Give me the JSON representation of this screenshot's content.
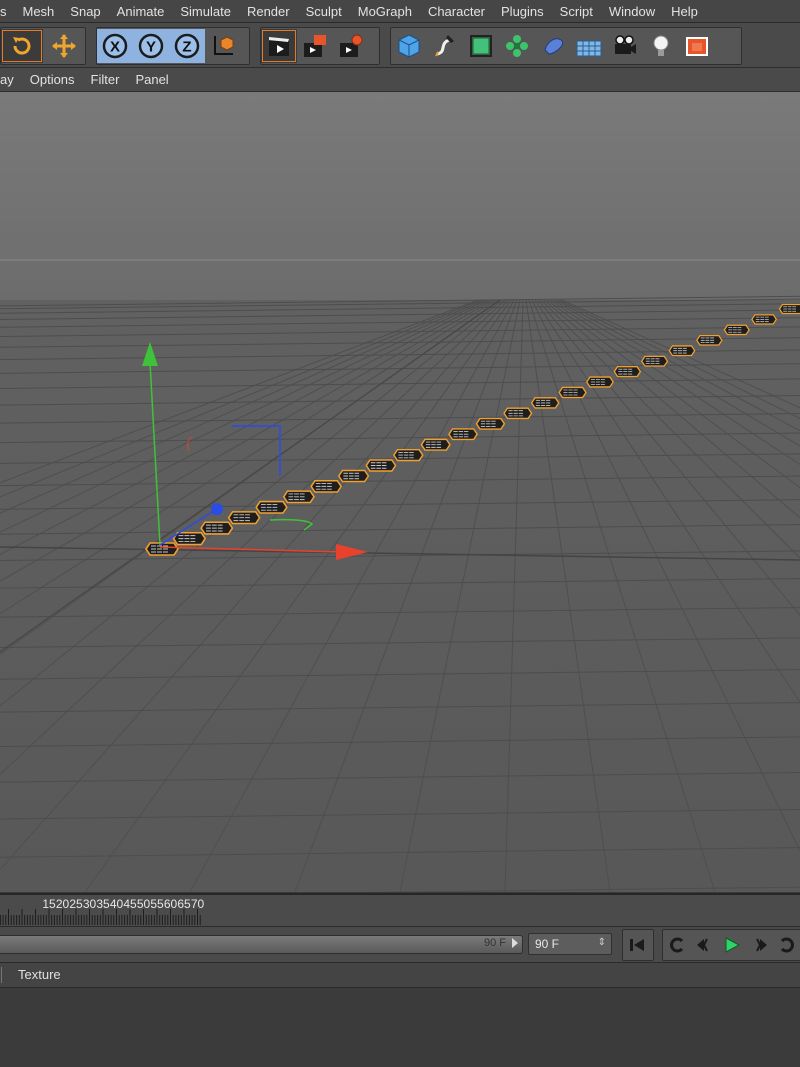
{
  "menu": [
    "s",
    "Mesh",
    "Snap",
    "Animate",
    "Simulate",
    "Render",
    "Sculpt",
    "MoGraph",
    "Character",
    "Plugins",
    "Script",
    "Window",
    "Help"
  ],
  "toolbar": {
    "groups": [
      {
        "icons": [
          "rotate-icon",
          "move-icon"
        ]
      },
      {
        "icons": [
          "x-axis-lock-icon",
          "y-axis-lock-icon",
          "z-axis-lock-icon",
          "world-coordinate-icon"
        ]
      },
      {
        "icons": [
          "render-view-icon",
          "render-picture-viewer-icon",
          "render-settings-icon"
        ]
      },
      {
        "icons": [
          "cube-icon",
          "spline-pen-icon",
          "subdivision-icon",
          "cloner-icon",
          "deformer-icon",
          "floor-icon",
          "camera-icon",
          "light-icon",
          "scene-icon"
        ]
      }
    ],
    "axis_labels": [
      "X",
      "Y",
      "Z"
    ]
  },
  "view_menu": [
    "ay",
    "Options",
    "Filter",
    "Panel"
  ],
  "viewport": {
    "object_count": 24,
    "axis_colors": {
      "x": "#e8412c",
      "y": "#3fc23a",
      "z": "#2a4ce8"
    },
    "selection_color": "#f0a030"
  },
  "timeline": {
    "ticks": [
      "15",
      "20",
      "25",
      "30",
      "35",
      "40",
      "45",
      "50",
      "55",
      "60",
      "65",
      "70"
    ],
    "range_end": "90 F",
    "current_frame": "90 F"
  },
  "attributes": {
    "tab": "Texture"
  }
}
